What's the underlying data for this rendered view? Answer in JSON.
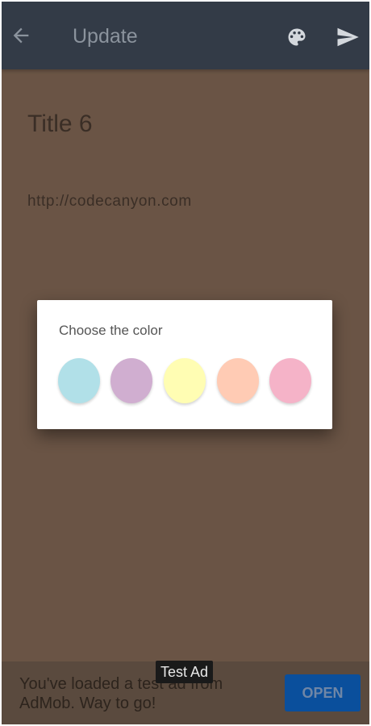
{
  "appbar": {
    "back_icon": "arrow-left-icon",
    "title": "Update",
    "palette_icon": "palette-icon",
    "send_icon": "send-icon"
  },
  "note": {
    "title": "Title 6",
    "body": "http://codecanyon.com"
  },
  "dialog": {
    "heading": "Choose the color",
    "swatches": [
      {
        "color": "#b1e0e8"
      },
      {
        "color": "#d0aed0"
      },
      {
        "color": "#fffdb3"
      },
      {
        "color": "#ffcbb4"
      },
      {
        "color": "#f5b3c8"
      }
    ]
  },
  "ad": {
    "badge": "Test Ad",
    "text": "You've loaded a test ad from AdMob. Way to go!",
    "button": "OPEN"
  },
  "colors": {
    "background": "#6a5445",
    "appbar": "#333b47",
    "ad_button": "#0a4f9c"
  }
}
